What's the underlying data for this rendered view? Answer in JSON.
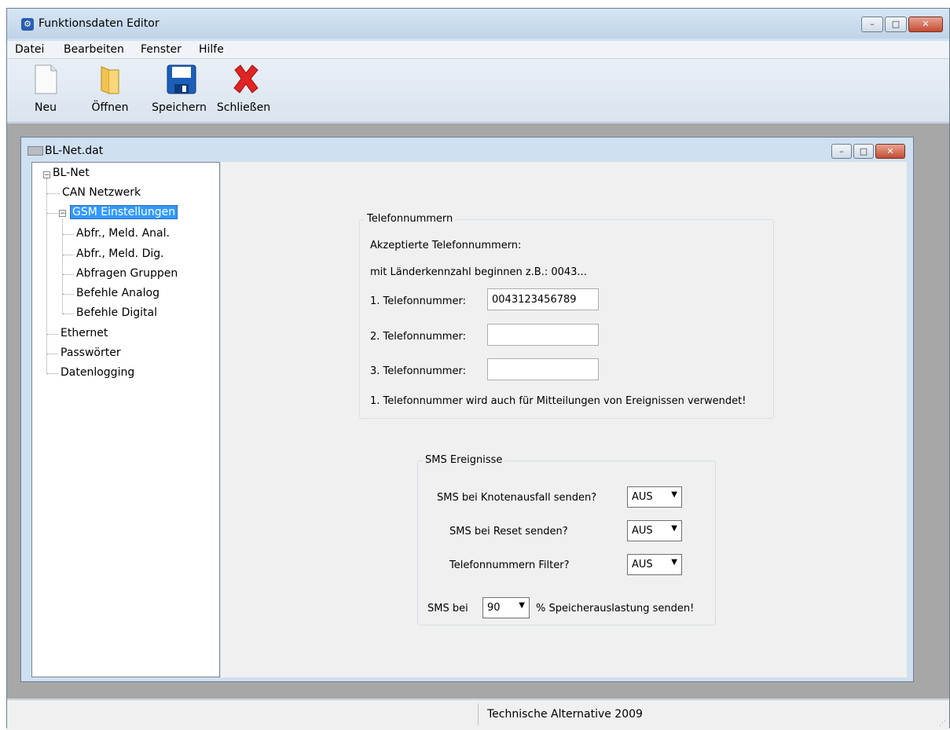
{
  "window": {
    "title": "Funktionsdaten Editor",
    "minimize": "–",
    "maximize": "□",
    "close": "✕"
  },
  "menu": [
    "Datei",
    "Bearbeiten",
    "Fenster",
    "Hilfe"
  ],
  "toolbar": {
    "new_label": "Neu",
    "open_label": "Öffnen",
    "save_label": "Speichern",
    "close_label": "Schließen"
  },
  "child": {
    "title": "BL-Net.dat"
  },
  "tree": {
    "root": "BL-Net",
    "can": "CAN Netzwerk",
    "gsm": "GSM Einstellungen",
    "gsm_children": [
      "Abfr., Meld. Anal.",
      "Abfr., Meld. Dig.",
      "Abfragen Gruppen",
      "Befehle Analog",
      "Befehle Digital"
    ],
    "ethernet": "Ethernet",
    "passwords": "Passwörter",
    "logging": "Datenlogging"
  },
  "phone_group": {
    "legend": "Telefonnummern",
    "accepted": "Akzeptierte Telefonnummern:",
    "hint": "mit Länderkennzahl beginnen z.B.:  0043...",
    "phone1_label": "1.  Telefonnummer:",
    "phone1_value": "0043123456789",
    "phone2_label": "2.  Telefonnummer:",
    "phone2_value": "",
    "phone3_label": "3.  Telefonnummer:",
    "phone3_value": "",
    "note": "1. Telefonnummer wird auch für Mitteilungen von Ereignissen verwendet!"
  },
  "sms_group": {
    "legend": "SMS Ereignisse",
    "node_failure_label": "SMS bei Knotenausfall senden?",
    "node_failure_value": "AUS",
    "reset_label": "SMS bei Reset senden?",
    "reset_value": "AUS",
    "filter_label": "Telefonnummern Filter?",
    "filter_value": "AUS",
    "memory_prefix": "SMS bei",
    "memory_value": "90",
    "memory_suffix": "%  Speicherauslastung senden!"
  },
  "status": {
    "text": "Technische Alternative 2009"
  },
  "icons": {
    "dropdown": "▼",
    "expander": "−"
  }
}
